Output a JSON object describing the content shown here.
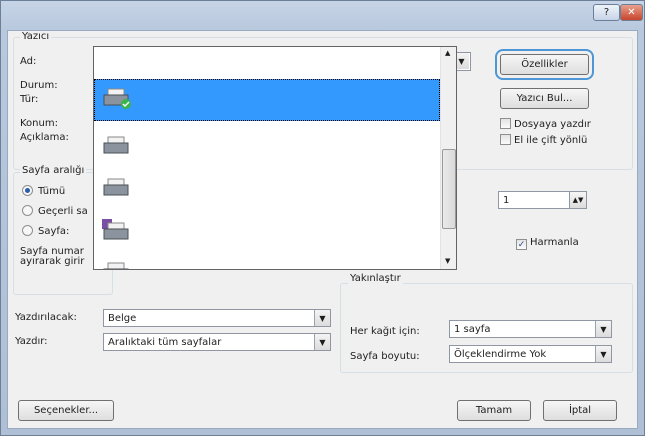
{
  "titlebar": {
    "help": "?",
    "close": "✕"
  },
  "printer": {
    "group": "Yazıcı",
    "name_label": "Ad:",
    "status_label": "Durum:",
    "type_label": "Tür:",
    "location_label": "Konum:",
    "comment_label": "Açıklama:",
    "properties": "Özellikler",
    "find_printer": "Yazıcı Bul...",
    "print_to_file": "Dosyaya yazdır",
    "manual_duplex": "El ile çift yönlü"
  },
  "range": {
    "group": "Sayfa aralığı",
    "all": "Tümü",
    "current": "Geçerli sa",
    "pages": "Sayfa:",
    "hint1": "Sayfa numar",
    "hint2": "ayırarak girir"
  },
  "copies": {
    "value": "1",
    "collate": "Harmanla"
  },
  "zoom": {
    "group": "Yakınlaştır",
    "per_sheet_label": "Her kağıt için:",
    "per_sheet_value": "1 sayfa",
    "scale_label": "Sayfa boyutu:",
    "scale_value": "Ölçeklendirme Yok"
  },
  "print_what": {
    "label": "Yazdırılacak:",
    "value": "Belge"
  },
  "print": {
    "label": "Yazdır:",
    "value": "Aralıktaki tüm sayfalar"
  },
  "buttons": {
    "options": "Seçenekler...",
    "ok": "Tamam",
    "cancel": "İptal"
  },
  "colors": {
    "selection": "#3399ff",
    "focus": "#4e96d6"
  }
}
